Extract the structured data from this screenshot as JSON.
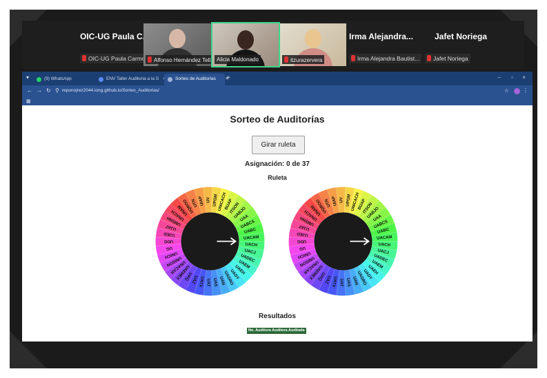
{
  "call": {
    "participants": [
      {
        "big_name": "OIC-UG Paula C...",
        "chip": "OIC-UG Paula Carmona"
      },
      {
        "chip": "Alfonso Hernández Tell..."
      },
      {
        "chip": "Alicia Maldonado"
      },
      {
        "chip": "itzurazervera"
      },
      {
        "big_name": "Irma  Alejandra...",
        "chip": "Irma Alejandra Bautist..."
      },
      {
        "big_name": "Jafet Noriega",
        "chip": "Jafet Noriega"
      }
    ]
  },
  "browser": {
    "tabs": [
      {
        "label": "(9) WhatsApp",
        "favicon_color": "#25d366"
      },
      {
        "label": "ENV Taller Auditoria a la S",
        "favicon_color": "#5b8cff"
      },
      {
        "label": "Sorteo de Auditorías",
        "favicon_color": "#9fb6d9"
      }
    ],
    "url": "reponojrez2044.iong.github.io/Sorteo_Auditorias/"
  },
  "page": {
    "title": "Sorteo de Auditorías",
    "spin_button": "Girar ruleta",
    "assignment": "Asignación: 0 de 37",
    "wheel_label": "Ruleta",
    "results_label": "Resultados",
    "results_header": "No. Auditora Auditora Auditada"
  },
  "wheel": {
    "segments": [
      "UIAP",
      "UV",
      "UPGM",
      "UNICACH",
      "BUAP",
      "ITSON",
      "UABJO",
      "UAA",
      "UABCS",
      "UABC",
      "UACAM",
      "UACH",
      "UACJ",
      "UADEC",
      "UAEM",
      "UAEH",
      "UADY",
      "UAGRO",
      "UAN",
      "UAS",
      "UAT",
      "UATX",
      "UAZ",
      "UAQ",
      "UAEMEX",
      "UNACAR",
      "UNISON",
      "UNICH",
      "UG",
      "UDG",
      "UJED",
      "UJAT",
      "UMSNH",
      "UNACH",
      "UNAM",
      "UQROO",
      "UTN"
    ],
    "colors_from": "#ff3b3b",
    "hub_color": "#1a1a1a"
  }
}
